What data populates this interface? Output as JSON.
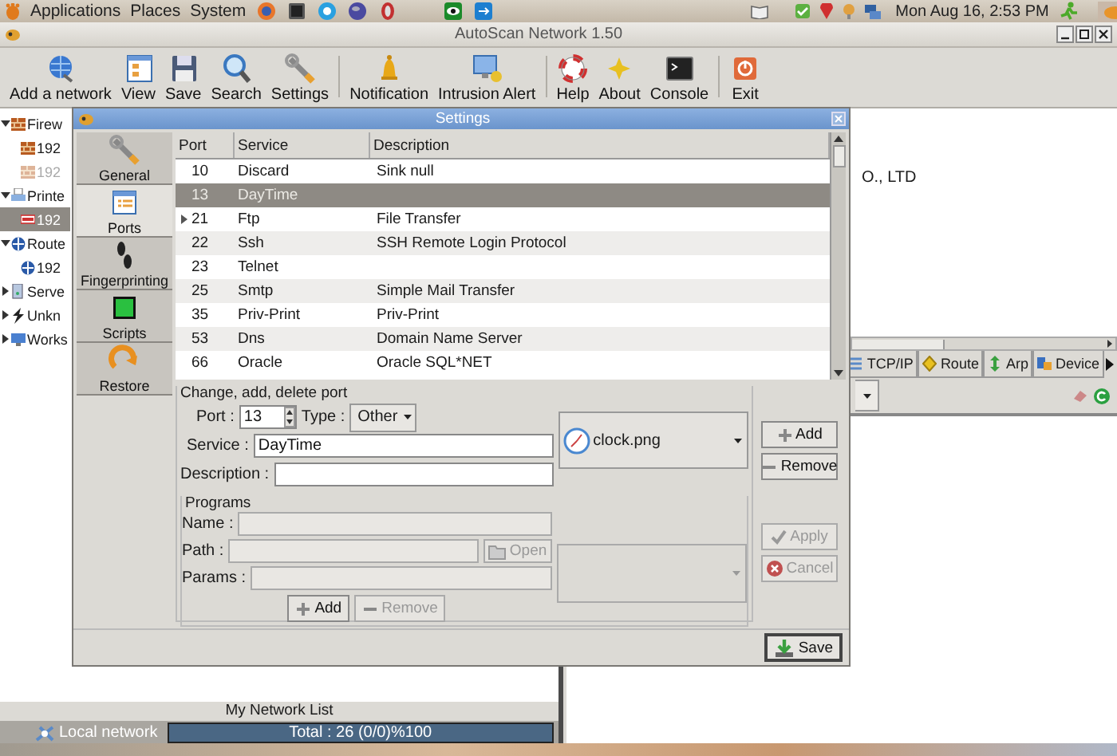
{
  "top_panel": {
    "menus": [
      "Applications",
      "Places",
      "System"
    ],
    "clock": "Mon Aug 16,  2:53 PM"
  },
  "window": {
    "title": "AutoScan Network 1.50"
  },
  "toolbar": [
    [
      "Add a network",
      "View",
      "Save",
      "Search",
      "Settings"
    ],
    [
      "Notification",
      "Intrusion Alert"
    ],
    [
      "Help",
      "About",
      "Console"
    ],
    [
      "Exit"
    ]
  ],
  "tree": [
    {
      "label": "Firew",
      "expanded": true,
      "selected": false,
      "children": [
        {
          "label": "192",
          "selected": false,
          "dimmed": false
        },
        {
          "label": "192",
          "selected": false,
          "dimmed": true
        }
      ]
    },
    {
      "label": "Printe",
      "expanded": true,
      "selected": false,
      "children": [
        {
          "label": "192",
          "selected": true,
          "dimmed": false
        }
      ]
    },
    {
      "label": "Route",
      "expanded": true,
      "selected": false,
      "children": [
        {
          "label": "192",
          "selected": false,
          "dimmed": false
        }
      ]
    },
    {
      "label": "Serve",
      "expanded": false,
      "selected": false
    },
    {
      "label": "Unkn",
      "expanded": false,
      "selected": false
    },
    {
      "label": "Works",
      "expanded": false,
      "selected": false
    }
  ],
  "list_title": "My Network List",
  "status": {
    "network": "Local network",
    "progress_text": "Total : 26  (0/0)%100",
    "level": 1
  },
  "details": {
    "text": "O., LTD",
    "tabs": [
      {
        "label": "TCP/IP",
        "selected": false
      },
      {
        "label": "Route",
        "selected": false
      },
      {
        "label": "Arp",
        "selected": false
      },
      {
        "label": "Device",
        "selected": false
      }
    ]
  },
  "dialog": {
    "title": "Settings",
    "sections": [
      {
        "label": "General",
        "selected": false
      },
      {
        "label": "Ports",
        "selected": true
      },
      {
        "label": "Fingerprinting",
        "selected": false
      },
      {
        "label": "Scripts",
        "selected": false
      },
      {
        "label": "Restore",
        "selected": false
      }
    ],
    "ports_table": {
      "columns": [
        "Port",
        "Service",
        "Description"
      ],
      "rows": [
        {
          "port": "10",
          "service": "Discard",
          "description": "Sink null",
          "selected": false,
          "expandable": false
        },
        {
          "port": "13",
          "service": "DayTime",
          "selected": true,
          "expandable": false
        },
        {
          "port": "21",
          "service": "Ftp",
          "description": "File Transfer",
          "selected": false,
          "expandable": true
        },
        {
          "port": "22",
          "service": "Ssh",
          "description": "SSH Remote Login Protocol",
          "selected": false,
          "expandable": false
        },
        {
          "port": "23",
          "service": "Telnet",
          "selected": false,
          "expandable": false
        },
        {
          "port": "25",
          "service": "Smtp",
          "description": "Simple Mail Transfer",
          "selected": false,
          "expandable": false
        },
        {
          "port": "35",
          "service": "Priv-Print",
          "description": "Priv-Print",
          "selected": false,
          "expandable": false
        },
        {
          "port": "53",
          "service": "Dns",
          "description": "Domain Name Server",
          "selected": false,
          "expandable": false
        },
        {
          "port": "66",
          "service": "Oracle",
          "description": "Oracle SQL*NET",
          "selected": false,
          "expandable": false
        }
      ]
    },
    "port_form": {
      "title": "Change, add, delete port",
      "port_label": "Port :",
      "port_value": "13",
      "type_label": "Type :",
      "type_value": "Other",
      "service_label": "Service :",
      "service_value": "DayTime",
      "description_label": "Description :",
      "icon_file": "clock.png"
    },
    "port_buttons": [
      {
        "label": "Add",
        "disabled": false
      },
      {
        "label": "Remove",
        "disabled": false
      }
    ],
    "programs": {
      "title": "Programs",
      "name_label": "Name :",
      "path_label": "Path :",
      "open_button": {
        "label": "Open",
        "disabled": true
      },
      "params_label": "Params :",
      "disabled": true,
      "buttons": [
        {
          "label": "Add",
          "disabled": false
        },
        {
          "label": "Remove",
          "disabled": true
        }
      ]
    },
    "action_buttons": [
      {
        "label": "Apply",
        "disabled": true
      },
      {
        "label": "Cancel",
        "disabled": true
      }
    ],
    "save_button": {
      "label": "Save"
    }
  }
}
